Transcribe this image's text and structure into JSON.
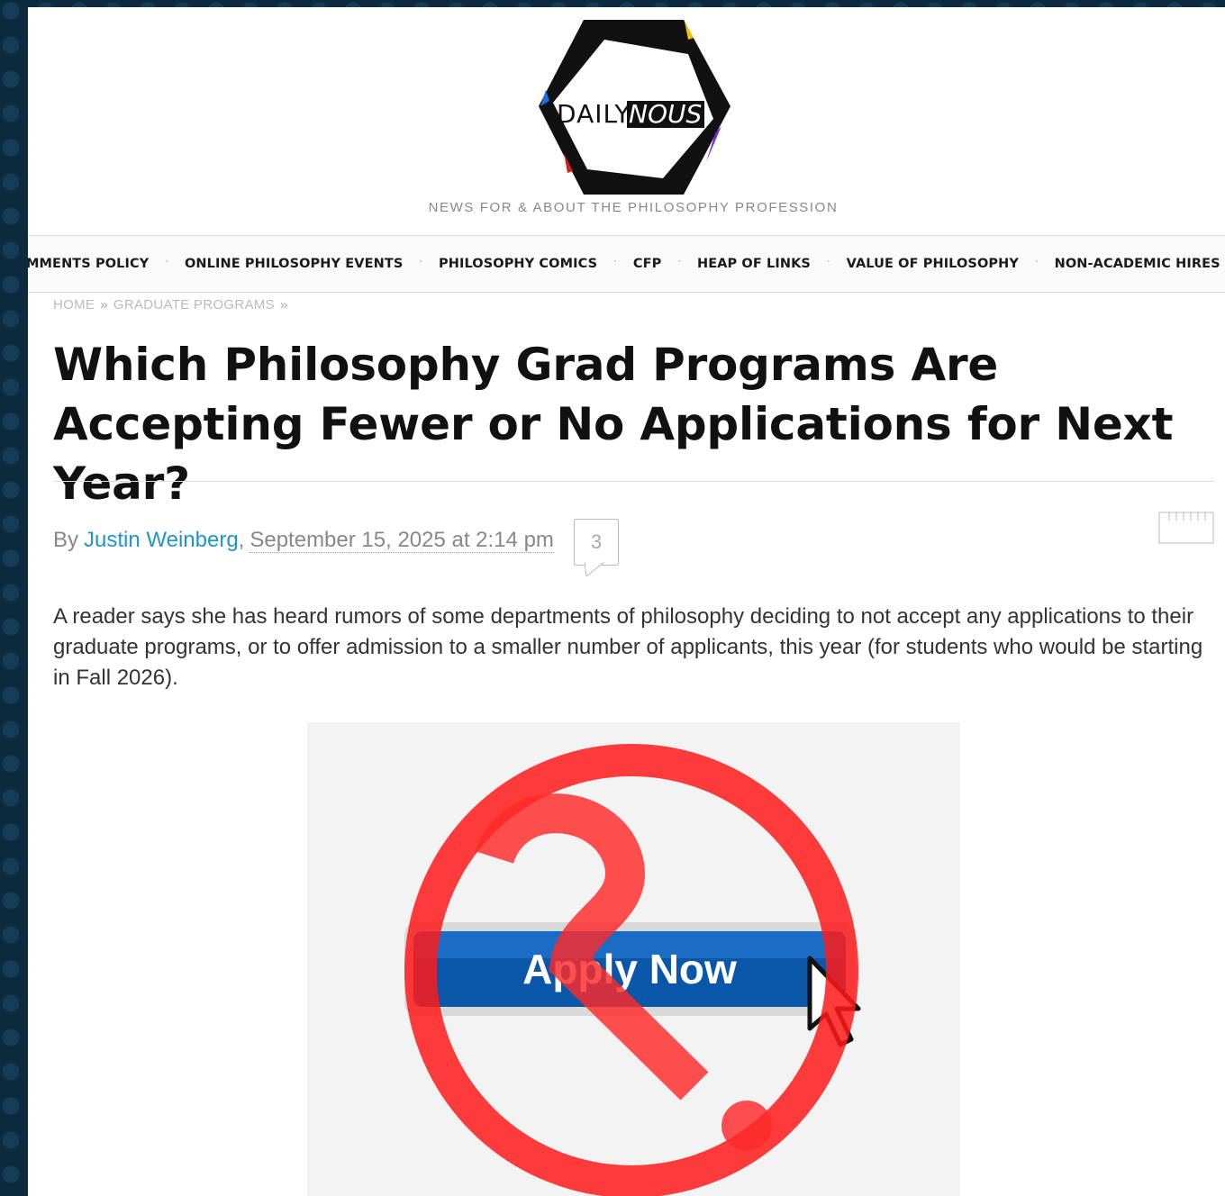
{
  "site": {
    "logo_text_left": "DAILY",
    "logo_text_right": "NOUS",
    "tagline": "NEWS FOR & ABOUT THE PHILOSOPHY PROFESSION"
  },
  "nav": {
    "items": [
      {
        "label": "MMENTS POLICY"
      },
      {
        "label": "ONLINE PHILOSOPHY EVENTS"
      },
      {
        "label": "PHILOSOPHY COMICS"
      },
      {
        "label": "CFP"
      },
      {
        "label": "HEAP OF LINKS"
      },
      {
        "label": "VALUE OF PHILOSOPHY"
      },
      {
        "label": "NON-ACADEMIC HIRES"
      }
    ],
    "separator": "·"
  },
  "breadcrumb": {
    "home": "HOME",
    "section": "GRADUATE PROGRAMS",
    "sep": "»"
  },
  "article": {
    "title": "Which Philosophy Grad Programs Are Accepting Fewer or No Applications for Next Year?",
    "by_prefix": "By",
    "author": "Justin Weinberg",
    "date": "September 15, 2025 at 2:14 pm",
    "comment_count": "3",
    "body": "A reader says she has heard rumors of some departments of philosophy deciding to not accept any applications to their graduate programs, or to offer admission to a smaller number of applicants, this year (for students who would be starting in Fall 2026).",
    "image": {
      "button_label": "Apply Now"
    }
  },
  "colors": {
    "background": "#0d2a3e",
    "link": "#2196c4",
    "prohibition_red": "#ff2a2a",
    "button_blue": "#0a56a8"
  },
  "icons": [
    "comment-bubble-icon",
    "share-icon",
    "prohibition-sign-icon",
    "question-mark-icon",
    "mouse-pointer-icon"
  ]
}
